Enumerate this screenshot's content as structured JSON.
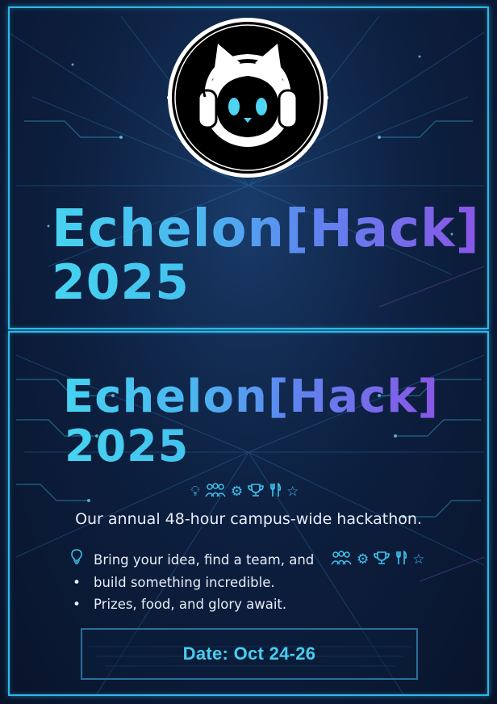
{
  "colors": {
    "background": "#0d1f40",
    "frame": "#2fb8e6",
    "accent_cyan": "#46d3f0",
    "accent_purple": "#8a55e6",
    "text": "#e8eef8"
  },
  "logo": {
    "icon": "cat-with-headphones-icon"
  },
  "top_panel": {
    "title_line1": "Echelon[Hack]",
    "title_line2": "2025"
  },
  "bottom_panel": {
    "title_line1": "Echelon[Hack]",
    "title_line2": "2025",
    "icon_row": [
      "lightbulb-icon",
      "team-icon",
      "gear-icon",
      "trophy-icon",
      "fork-knife-icon",
      "star-icon"
    ],
    "tagline": "Our annual 48-hour campus-wide hackathon.",
    "bullets": [
      {
        "marker": "lightbulb-icon",
        "text": "Bring your idea, find a team, and"
      },
      {
        "marker": "dot",
        "text": "build something incredible."
      },
      {
        "marker": "dot",
        "text": "Prizes, food, and glory await."
      }
    ],
    "date": "Date: Oct 24-26"
  }
}
